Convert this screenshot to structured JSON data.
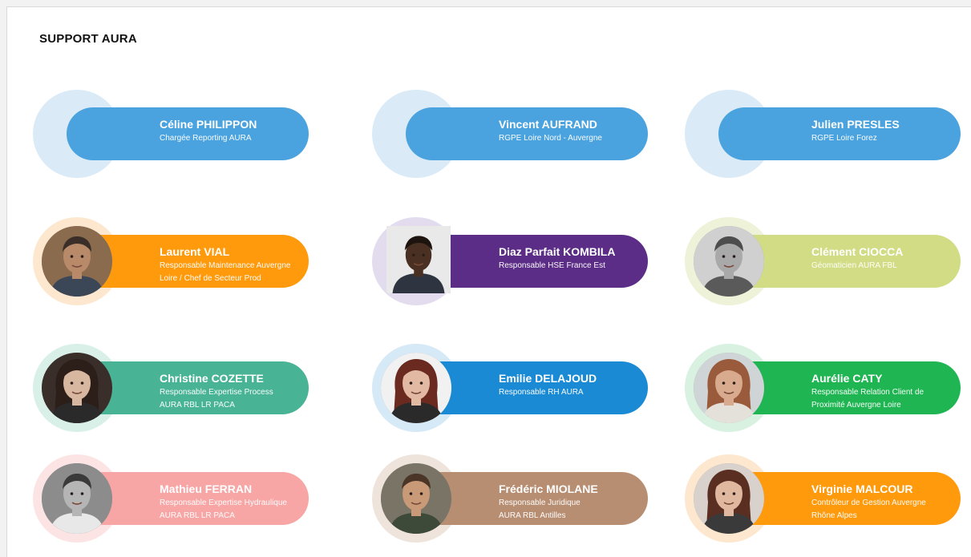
{
  "title": "SUPPORT AURA",
  "people": [
    {
      "name": "Céline PHILIPPON",
      "role": [
        "Chargée Reporting AURA"
      ],
      "color": "#4aa3de",
      "ring": "#daebf7",
      "photo": false,
      "photo_icon": ""
    },
    {
      "name": "Vincent AUFRAND",
      "role": [
        "RGPE Loire Nord - Auvergne"
      ],
      "color": "#4aa3de",
      "ring": "#daebf7",
      "photo": false,
      "photo_icon": ""
    },
    {
      "name": "Julien PRESLES",
      "role": [
        "RGPE Loire Forez"
      ],
      "color": "#4aa3de",
      "ring": "#daebf7",
      "photo": false,
      "photo_icon": ""
    },
    {
      "name": "Laurent VIAL",
      "role": [
        "Responsable Maintenance Auvergne",
        "Loire / Chef de Secteur Prod"
      ],
      "color": "#ff9a0d",
      "ring": "#fde8cf",
      "photo": true,
      "photo_icon": "man-photo",
      "skin": "#b88a6a",
      "hair": "#3a2f28",
      "bg": "#8a6b4e",
      "shirt": "#3b4656"
    },
    {
      "name": "Diaz Parfait KOMBILA",
      "role": [
        "Responsable HSE France Est"
      ],
      "color": "#5b2d86",
      "ring": "#e3dcef",
      "photo": true,
      "photo_icon": "man-photo",
      "skin": "#4a3022",
      "hair": "#1d1410",
      "bg": "#e9e9e9",
      "shirt": "#2e3440",
      "square": true
    },
    {
      "name": "Clément CIOCCA",
      "role": [
        "Géomaticien AURA FBL"
      ],
      "color": "#d2dc84",
      "ring": "#eef2d8",
      "photo": true,
      "photo_icon": "man-photo",
      "skin": "#a9a9a9",
      "hair": "#4d4d4d",
      "bg": "#d0d0d0",
      "shirt": "#5a5a5a"
    },
    {
      "name": "Christine COZETTE",
      "role": [
        "Responsable Expertise Process",
        "AURA RBL LR PACA"
      ],
      "color": "#48b395",
      "ring": "#d9f0e8",
      "photo": true,
      "photo_icon": "woman-photo",
      "skin": "#d8b7a0",
      "hair": "#2c1f1a",
      "bg": "#3a2e2a",
      "shirt": "#2a2a2a"
    },
    {
      "name": "Emilie DELAJOUD",
      "role": [
        "Responsable RH AURA"
      ],
      "color": "#1a8ad4",
      "ring": "#d6e9f6",
      "photo": true,
      "photo_icon": "woman-photo",
      "skin": "#e2b9a2",
      "hair": "#6b2a1f",
      "bg": "#f1f1f1",
      "shirt": "#2a2a2a"
    },
    {
      "name": "Aurélie CATY",
      "role": [
        "Responsable Relation Client de",
        "Proximité Auvergne Loire"
      ],
      "color": "#1fb552",
      "ring": "#d8f1e0",
      "photo": true,
      "photo_icon": "woman-photo",
      "skin": "#d9ab8e",
      "hair": "#9a5a3c",
      "bg": "#cfd4d6",
      "shirt": "#e4e0da"
    },
    {
      "name": "Mathieu FERRAN",
      "role": [
        "Responsable Expertise Hydraulique",
        "AURA RBL LR PACA"
      ],
      "color": "#f8a5a5",
      "ring": "#fde4e4",
      "photo": true,
      "photo_icon": "man-photo",
      "skin": "#b5b5b5",
      "hair": "#3a3a3a",
      "bg": "#8c8c8c",
      "shirt": "#e8e8e8"
    },
    {
      "name": "Frédéric MIOLANE",
      "role": [
        "Responsable Juridique",
        "AURA RBL Antilles"
      ],
      "color": "#b88e73",
      "ring": "#efe4dc",
      "photo": true,
      "photo_icon": "man-photo",
      "skin": "#c99a78",
      "hair": "#4a3526",
      "bg": "#7a7466",
      "shirt": "#3d4a3a"
    },
    {
      "name": "Virginie MALCOUR",
      "role": [
        "Contrôleur de Gestion Auvergne",
        "Rhône Alpes"
      ],
      "color": "#ff9a0d",
      "ring": "#fde8cf",
      "photo": true,
      "photo_icon": "woman-photo",
      "skin": "#e0b8a0",
      "hair": "#5a2f22",
      "bg": "#d9d2cc",
      "shirt": "#3a3a3a"
    }
  ]
}
